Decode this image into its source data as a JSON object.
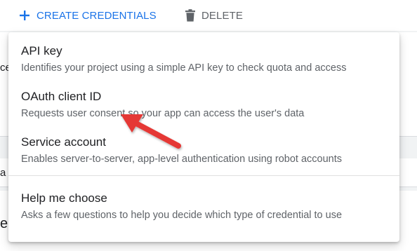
{
  "toolbar": {
    "create_label": "CREATE CREDENTIALS",
    "delete_label": "DELETE",
    "create_icon": "plus-icon",
    "delete_icon": "trash-icon",
    "accent_color": "#1a73e8",
    "muted_color": "#5f6368"
  },
  "background": {
    "fragment_1": "ce",
    "fragment_2": "a",
    "fragment_3": "e"
  },
  "menu": {
    "items": [
      {
        "title": "API key",
        "description": "Identifies your project using a simple API key to check quota and access"
      },
      {
        "title": "OAuth client ID",
        "description": "Requests user consent so your app can access the user's data"
      },
      {
        "title": "Service account",
        "description": "Enables server-to-server, app-level authentication using robot accounts"
      },
      {
        "title": "Help me choose",
        "description": "Asks a few questions to help you decide which type of credential to use"
      }
    ]
  },
  "annotation": {
    "arrow_color": "#e53935",
    "icon": "arrow-annotation-icon"
  }
}
